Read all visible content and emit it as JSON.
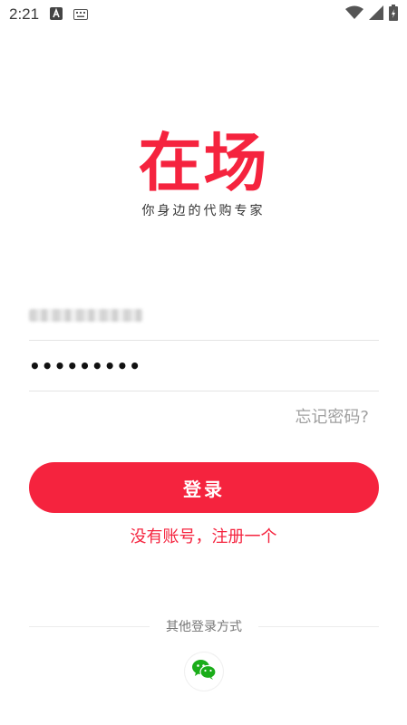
{
  "status_bar": {
    "time": "2:21",
    "icons": [
      "a-notification-icon",
      "keyboard-icon",
      "wifi-icon",
      "signal-icon",
      "battery-icon"
    ]
  },
  "logo": {
    "title": "在场",
    "slogan": "你身边的代购专家"
  },
  "login_form": {
    "account_value": "",
    "password_value": "•••••••••",
    "forgot_label": "忘记密码?",
    "login_label": "登录",
    "register_label": "没有账号，注册一个"
  },
  "other_login": {
    "label": "其他登录方式",
    "options": [
      "wechat-icon"
    ]
  },
  "colors": {
    "accent": "#f5233e",
    "wechat": "#1aad19"
  }
}
